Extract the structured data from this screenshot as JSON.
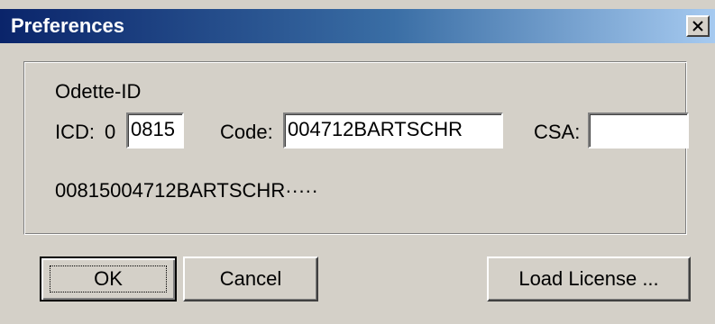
{
  "window": {
    "title": "Preferences",
    "close_glyph": "✕"
  },
  "odette": {
    "group_label": "Odette-ID",
    "icd_label": "ICD:",
    "icd_prefix": "0",
    "icd_value": "0815",
    "code_label": "Code:",
    "code_value": "004712BARTSCHR",
    "csa_label": "CSA:",
    "csa_value": "",
    "preview": "00815004712BARTSCHR·····"
  },
  "buttons": {
    "ok": "OK",
    "cancel": "Cancel",
    "load_license": "Load License ..."
  },
  "colors": {
    "titlebar_start": "#0a246a",
    "titlebar_end": "#a6caf0",
    "face": "#d4d0c8"
  }
}
